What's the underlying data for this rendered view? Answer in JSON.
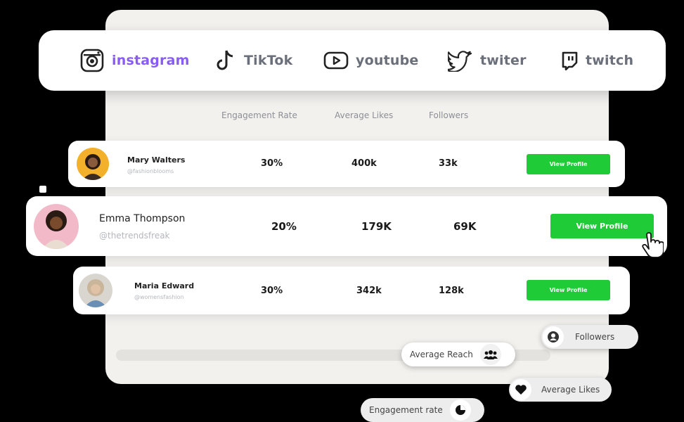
{
  "platforms": [
    {
      "label": "instagram",
      "icon": "instagram-icon",
      "active": true
    },
    {
      "label": "TikTok",
      "icon": "tiktok-icon",
      "active": false
    },
    {
      "label": "youtube",
      "icon": "youtube-icon",
      "active": false
    },
    {
      "label": "twiter",
      "icon": "twitter-icon",
      "active": false
    },
    {
      "label": "twitch",
      "icon": "twitch-icon",
      "active": false
    }
  ],
  "table": {
    "headers": [
      "Engagement Rate",
      "Average Likes",
      "Followers"
    ],
    "rows": [
      {
        "name": "Mary Walters",
        "handle": "@fashionblooms",
        "engagement": "30%",
        "likes": "400k",
        "followers": "33k",
        "button": "View Profile"
      },
      {
        "name": "Emma Thompson",
        "handle": "@thetrendsfreak",
        "engagement": "20%",
        "likes": "179K",
        "followers": "69K",
        "button": "View Profile"
      },
      {
        "name": "Maria Edward",
        "handle": "@womensfashion",
        "engagement": "30%",
        "likes": "342k",
        "followers": "128k",
        "button": "View Profile"
      }
    ]
  },
  "chips": {
    "followers": "Followers",
    "average_reach": "Average Reach",
    "average_likes": "Average Likes",
    "engagement_rate": "Engagement rate"
  },
  "colors": {
    "accent_purple": "#8a5cf6",
    "button_green": "#1fcb36",
    "background": "#000000"
  }
}
